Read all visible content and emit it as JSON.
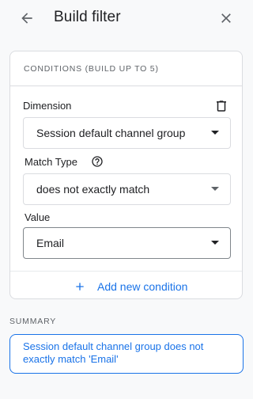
{
  "header": {
    "back_icon": "arrow-back-icon",
    "title": "Build filter",
    "close_icon": "close-icon"
  },
  "conditions": {
    "heading": "CONDITIONS (BUILD UP TO 5)",
    "dimension": {
      "label": "Dimension",
      "value": "Session default channel group",
      "delete_icon": "trash-icon"
    },
    "match_type": {
      "label": "Match Type",
      "help_icon": "help-circle-icon",
      "value": "does not exactly match"
    },
    "value_field": {
      "label": "Value",
      "value": "Email"
    },
    "add_condition_label": "Add new condition"
  },
  "summary": {
    "heading": "SUMMARY",
    "text": "Session default channel group does not exactly match 'Email'"
  },
  "colors": {
    "accent": "#1a73e8",
    "background": "#f8f9fa",
    "border": "#dadce0"
  }
}
